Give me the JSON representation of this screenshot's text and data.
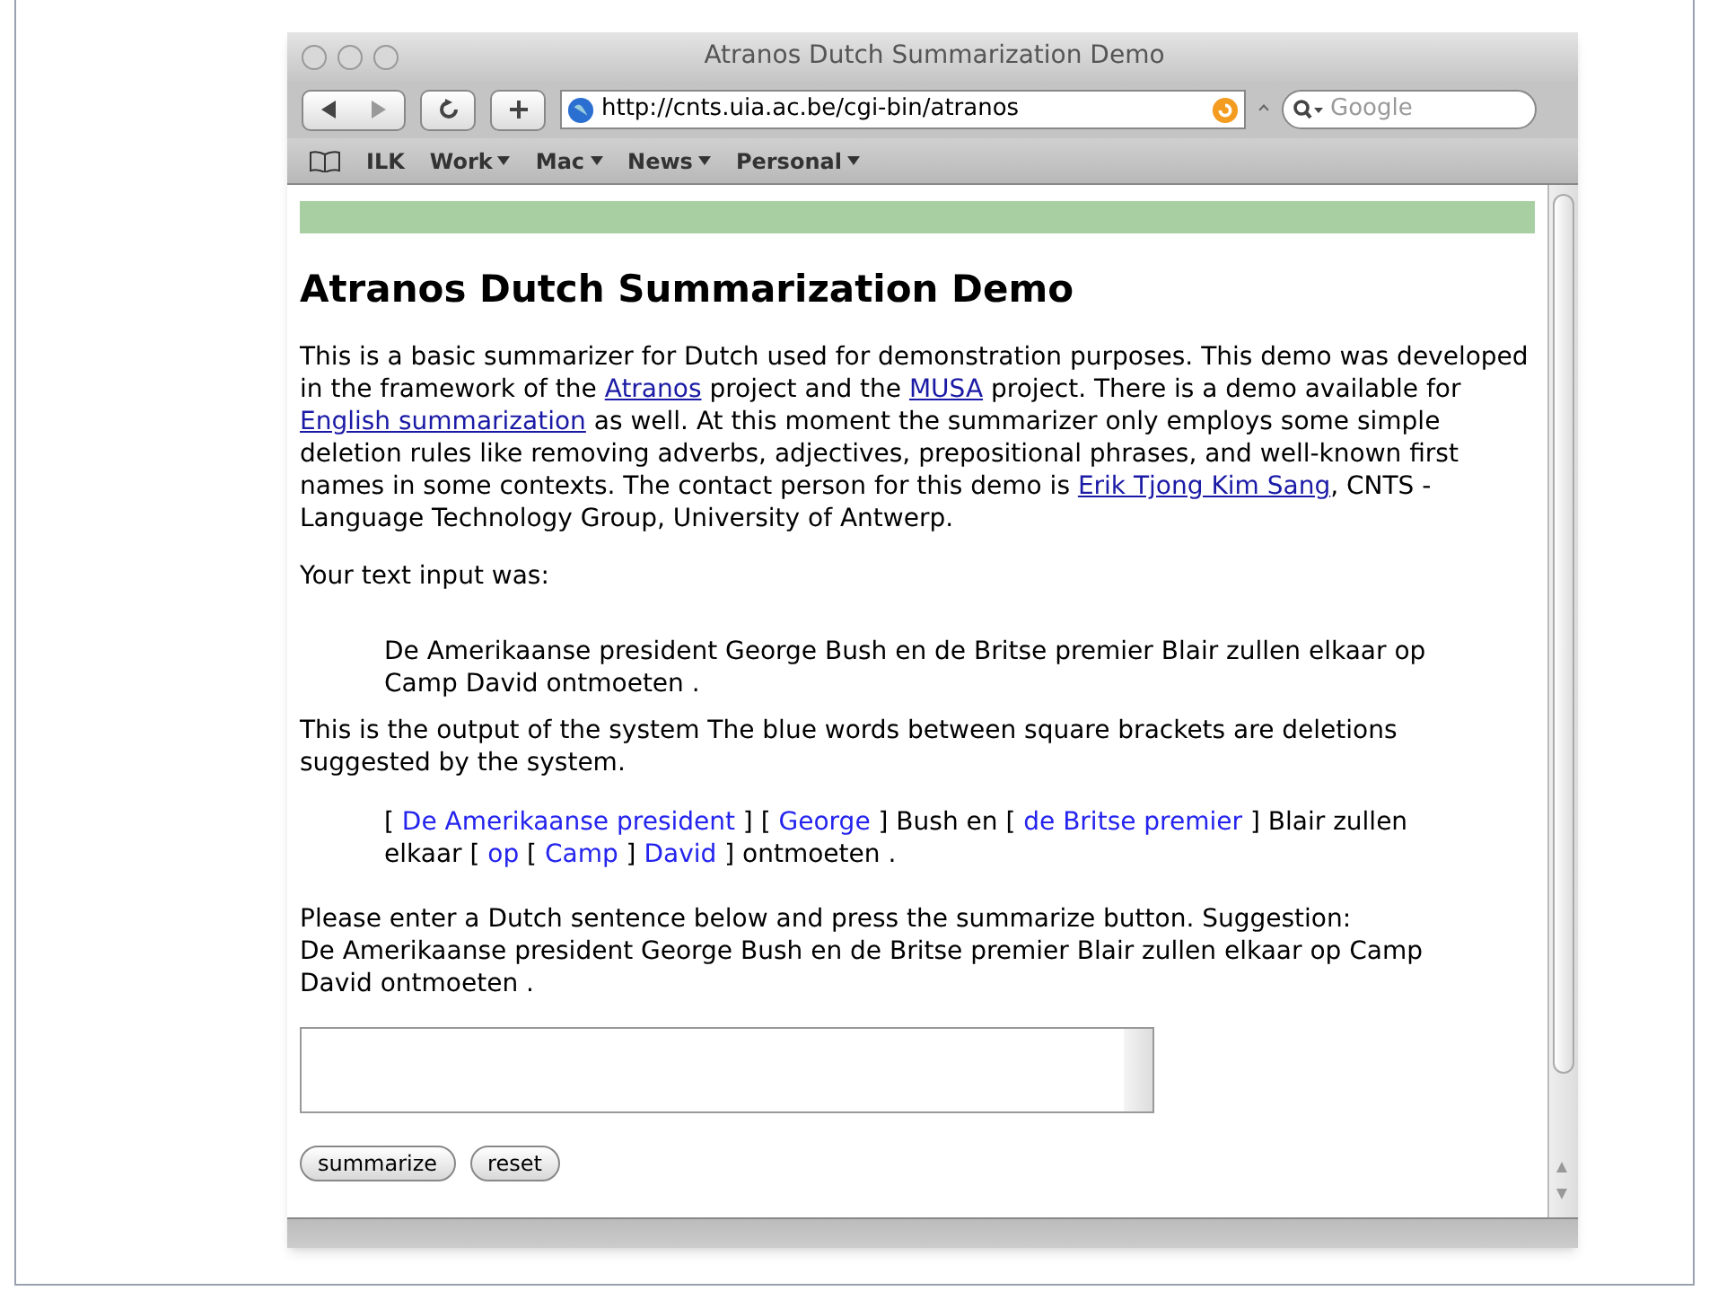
{
  "window": {
    "title": "Atranos Dutch Summarization Demo"
  },
  "toolbar": {
    "url": "http://cnts.uia.ac.be/cgi-bin/atranos",
    "search_placeholder": "Google"
  },
  "bookmarks": [
    {
      "label": "ILK",
      "menu": false
    },
    {
      "label": "Work",
      "menu": true
    },
    {
      "label": "Mac",
      "menu": true
    },
    {
      "label": "News",
      "menu": true
    },
    {
      "label": "Personal",
      "menu": true
    }
  ],
  "page": {
    "heading": "Atranos Dutch Summarization Demo",
    "intro": [
      {
        "text": "This is a basic summarizer for Dutch used for demonstration purposes. This demo was developed in the framework of the ",
        "link": false
      },
      {
        "text": "Atranos",
        "link": true
      },
      {
        "text": " project and the ",
        "link": false
      },
      {
        "text": "MUSA",
        "link": true
      },
      {
        "text": " project. There is a demo available for ",
        "link": false
      },
      {
        "text": "English summarization",
        "link": true
      },
      {
        "text": " as well. At this moment the summarizer only employs some simple deletion rules like removing adverbs, adjectives, prepositional phrases, and well-known first names in some contexts. The contact person for this demo is ",
        "link": false
      },
      {
        "text": "Erik Tjong Kim Sang",
        "link": true
      },
      {
        "text": ", CNTS - Language Technology Group, University of Antwerp.",
        "link": false
      }
    ],
    "input_label": "Your text input was:",
    "input_text": "De Amerikaanse president George Bush en de Britse premier Blair zullen elkaar op Camp David ontmoeten .",
    "output_label": "This is the output of the system The blue words between square brackets are deletions suggested by the system.",
    "output": [
      {
        "text": "[ ",
        "deleted": false
      },
      {
        "text": "De Amerikaanse president",
        "deleted": true
      },
      {
        "text": " ] [ ",
        "deleted": false
      },
      {
        "text": "George",
        "deleted": true
      },
      {
        "text": " ] Bush en [ ",
        "deleted": false
      },
      {
        "text": "de Britse premier",
        "deleted": true
      },
      {
        "text": " ] Blair zullen elkaar [ ",
        "deleted": false
      },
      {
        "text": "op",
        "deleted": true
      },
      {
        "text": " [ ",
        "deleted": false
      },
      {
        "text": "Camp",
        "deleted": true
      },
      {
        "text": " ] ",
        "deleted": false
      },
      {
        "text": "David",
        "deleted": true
      },
      {
        "text": " ] ontmoeten .",
        "deleted": false
      }
    ],
    "prompt": "Please enter a Dutch sentence below and press the summarize button. Suggestion:",
    "suggestion": "De Amerikaanse president George Bush en de Britse premier Blair zullen elkaar op Camp David ontmoeten .",
    "buttons": [
      "summarize",
      "reset"
    ]
  }
}
